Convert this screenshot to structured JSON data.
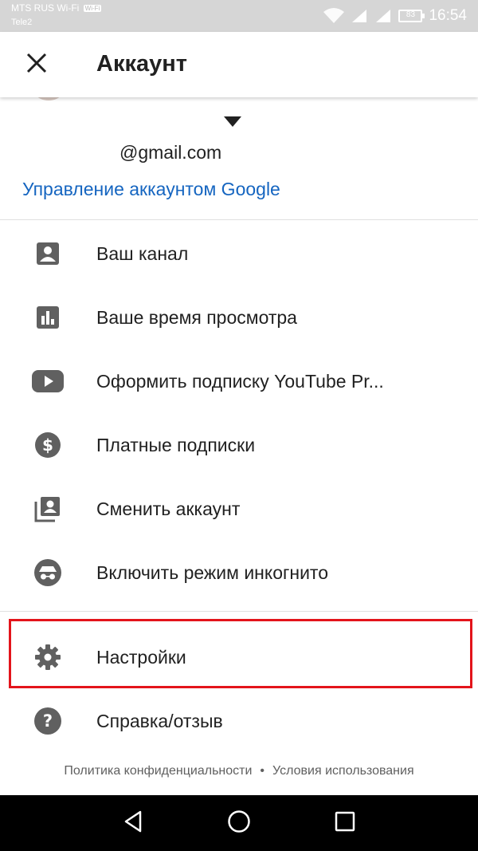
{
  "status_bar": {
    "carrier_primary": "MTS RUS Wi-Fi",
    "wifi_badge": "Wi-Fi",
    "carrier_secondary": "Tele2",
    "battery": "83",
    "time": "16:54"
  },
  "app_bar": {
    "title": "Аккаунт"
  },
  "account": {
    "email": "@gmail.com",
    "manage_link": "Управление аккаунтом Google"
  },
  "menu": {
    "items": [
      {
        "label": "Ваш канал",
        "icon": "account-box-icon"
      },
      {
        "label": "Ваше время просмотра",
        "icon": "bar-chart-icon"
      },
      {
        "label": "Оформить подписку YouTube Pr...",
        "icon": "youtube-icon"
      },
      {
        "label": "Платные подписки",
        "icon": "dollar-icon"
      },
      {
        "label": "Сменить аккаунт",
        "icon": "switch-account-icon"
      },
      {
        "label": "Включить режим инкогнито",
        "icon": "incognito-icon"
      },
      {
        "label": "Настройки",
        "icon": "gear-icon"
      },
      {
        "label": "Справка/отзыв",
        "icon": "help-icon"
      }
    ]
  },
  "footer": {
    "privacy": "Политика конфиденциальности",
    "separator": "•",
    "terms": "Условия использования"
  },
  "colors": {
    "link": "#1565c0",
    "icon": "#606060",
    "highlight": "#e3141b"
  }
}
